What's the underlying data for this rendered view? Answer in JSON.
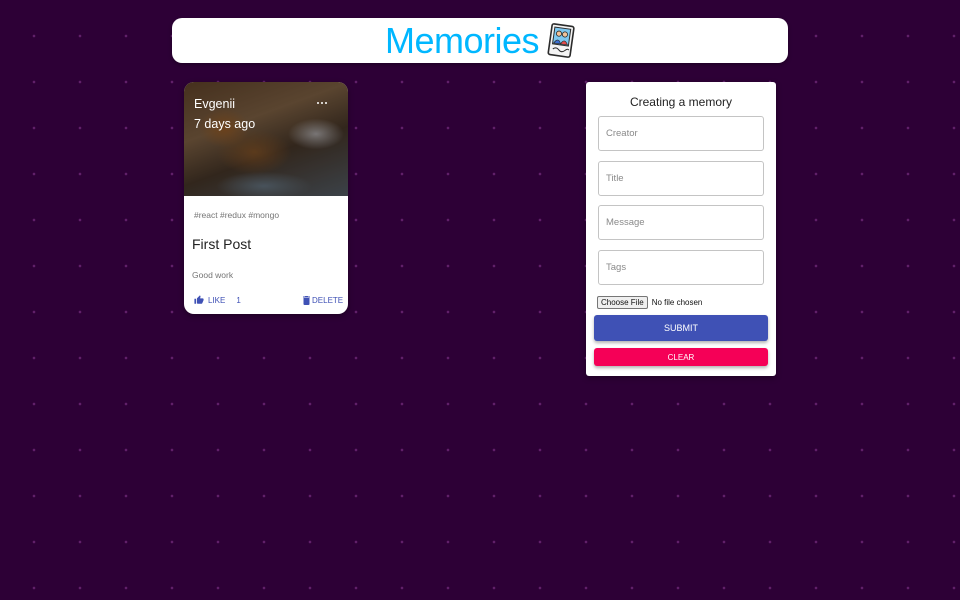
{
  "header": {
    "title": "Memories",
    "logo_icon": "memories-photo-icon"
  },
  "posts": [
    {
      "creator": "Evgenii",
      "time_ago": "7 days ago",
      "tags": "#react #redux #mongo",
      "title": "First Post",
      "message": "Good work",
      "like_label": "LIKE",
      "like_count": "1",
      "delete_label": "DELETE",
      "image_description_icon": "cat-photo"
    }
  ],
  "form": {
    "title": "Creating a memory",
    "creator_placeholder": "Creator",
    "title_placeholder": "Title",
    "message_placeholder": "Message",
    "tags_placeholder": "Tags",
    "choose_file_label": "Choose File",
    "file_status": "No file chosen",
    "submit_label": "SUBMIT",
    "clear_label": "CLEAR"
  },
  "colors": {
    "background": "#2d0036",
    "title_accent": "#00b7ff",
    "primary": "#3f51b5",
    "secondary": "#f50057"
  }
}
